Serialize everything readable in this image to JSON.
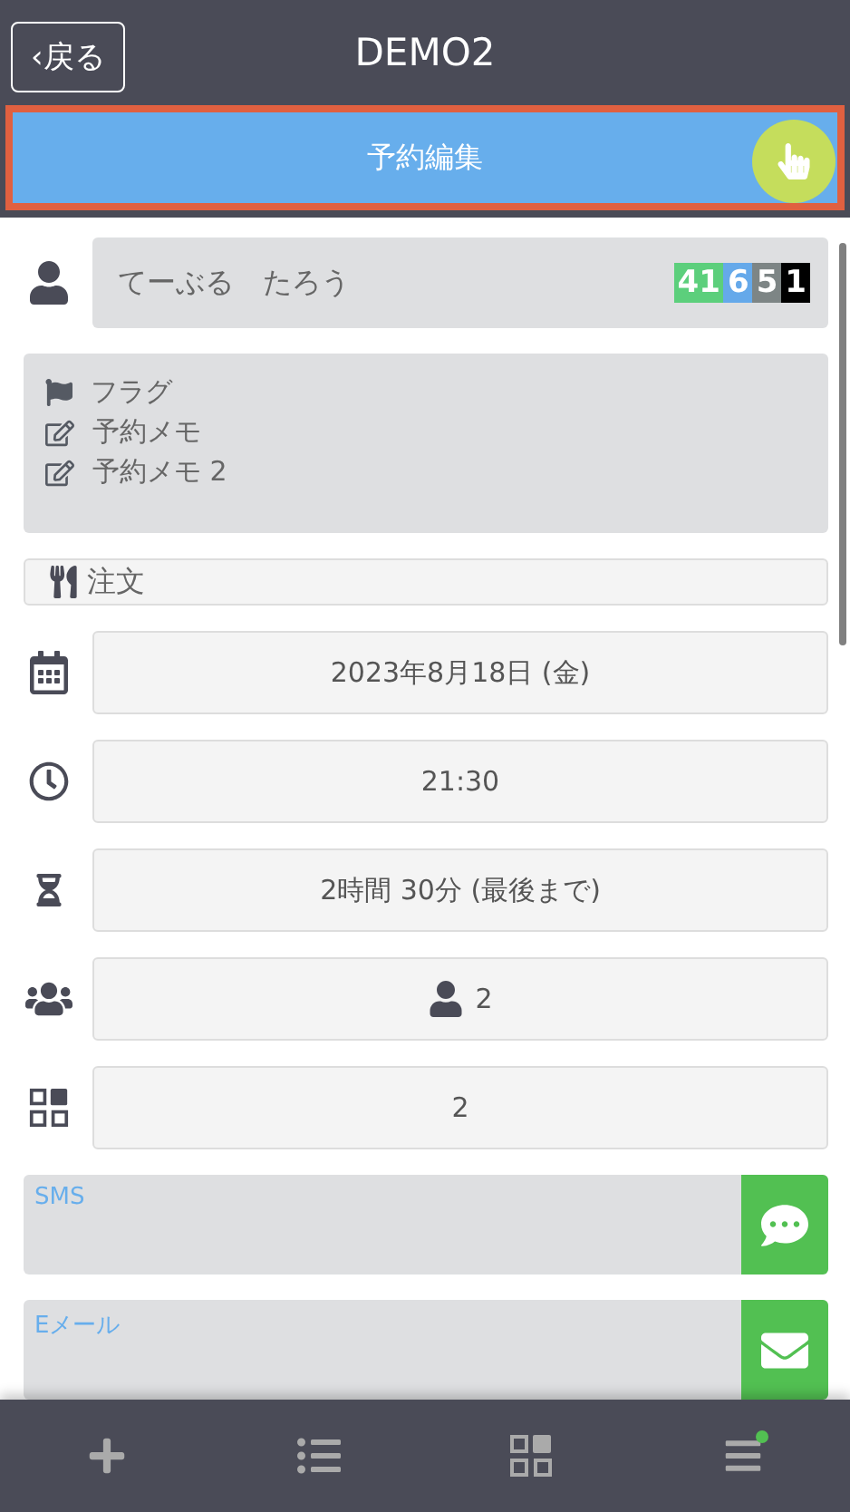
{
  "header": {
    "back_label": "‹戻る",
    "title": "DEMO2"
  },
  "edit_bar": {
    "label": "予約編集",
    "highlighted": true
  },
  "guest": {
    "name": "てーぶる　たろう",
    "badges": [
      {
        "text": "41",
        "color": "#5ccf7c"
      },
      {
        "text": "6",
        "color": "#65a9ea"
      },
      {
        "text": "5",
        "color": "#7d8585"
      },
      {
        "text": "1",
        "color": "#000000"
      }
    ]
  },
  "notes": [
    {
      "kind": "flag",
      "label": "フラグ"
    },
    {
      "kind": "memo",
      "label": "予約メモ"
    },
    {
      "kind": "memo",
      "label": "予約メモ 2"
    }
  ],
  "order": {
    "label": "注文"
  },
  "fields": [
    {
      "kind": "date",
      "value": "2023年8月18日 (金)"
    },
    {
      "kind": "time",
      "value": "21:30"
    },
    {
      "kind": "duration",
      "value": "2時間 30分 (最後まで)"
    },
    {
      "kind": "people",
      "value": "2"
    },
    {
      "kind": "table",
      "value": "2"
    }
  ],
  "messages": [
    {
      "kind": "sms",
      "label": "SMS"
    },
    {
      "kind": "email",
      "label": "Eメール"
    }
  ],
  "nav": [
    {
      "kind": "add",
      "notification": false
    },
    {
      "kind": "list",
      "notification": false
    },
    {
      "kind": "grid",
      "notification": false
    },
    {
      "kind": "menu",
      "notification": true
    }
  ]
}
